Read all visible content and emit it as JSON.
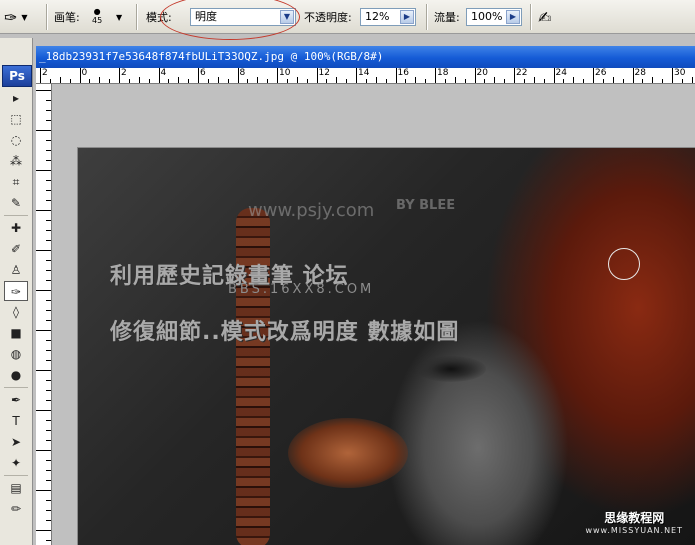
{
  "options_bar": {
    "brush_label": "画笔:",
    "brush_size": "45",
    "mode_label": "模式:",
    "mode_value": "明度",
    "opacity_label": "不透明度:",
    "opacity_value": "12%",
    "flow_label": "流量:",
    "flow_value": "100%"
  },
  "toolbox": {
    "logo": "Ps",
    "tools": [
      {
        "name": "move-tool",
        "glyph": "▸"
      },
      {
        "name": "marquee-tool",
        "glyph": "⬚"
      },
      {
        "name": "lasso-tool",
        "glyph": "◌"
      },
      {
        "name": "magic-wand-tool",
        "glyph": "⁂"
      },
      {
        "name": "crop-tool",
        "glyph": "⌗"
      },
      {
        "name": "slice-tool",
        "glyph": "✎"
      },
      {
        "name": "healing-brush-tool",
        "glyph": "✚"
      },
      {
        "name": "brush-tool",
        "glyph": "✐"
      },
      {
        "name": "clone-stamp-tool",
        "glyph": "♙"
      },
      {
        "name": "history-brush-tool",
        "glyph": "✑"
      },
      {
        "name": "eraser-tool",
        "glyph": "◊"
      },
      {
        "name": "gradient-tool",
        "glyph": "■"
      },
      {
        "name": "blur-tool",
        "glyph": "◍"
      },
      {
        "name": "dodge-tool",
        "glyph": "●"
      },
      {
        "name": "pen-tool",
        "glyph": "✒"
      },
      {
        "name": "type-tool",
        "glyph": "T"
      },
      {
        "name": "path-selection-tool",
        "glyph": "➤"
      },
      {
        "name": "shape-tool",
        "glyph": "✦"
      },
      {
        "name": "notes-tool",
        "glyph": "▤"
      },
      {
        "name": "eyedropper-tool",
        "glyph": "✏"
      }
    ]
  },
  "document": {
    "title": "_18db23931f7e53648f874fbULiT33OQZ.jpg @ 100%(RGB/8#)",
    "ruler_labels": [
      "2",
      "0",
      "2",
      "4",
      "6",
      "8",
      "10",
      "12",
      "14",
      "16",
      "18",
      "20",
      "22",
      "24",
      "26",
      "28",
      "30"
    ]
  },
  "watermark": {
    "line1": "利用歷史記錄畫筆 论坛",
    "line2": "修復細節..模式改爲明度 數據如圖",
    "sub": "BBS.16XX8.COM",
    "site": "www.psjy.com",
    "signature": "BY BLEE",
    "corner_cn": "思缘教程网",
    "corner_url": "www.MISSYUAN.NET"
  },
  "colors": {
    "titlebar": "#155bd6",
    "highlight_ellipse": "#c43a2c",
    "canvas_gray": "#c0c0c0"
  }
}
